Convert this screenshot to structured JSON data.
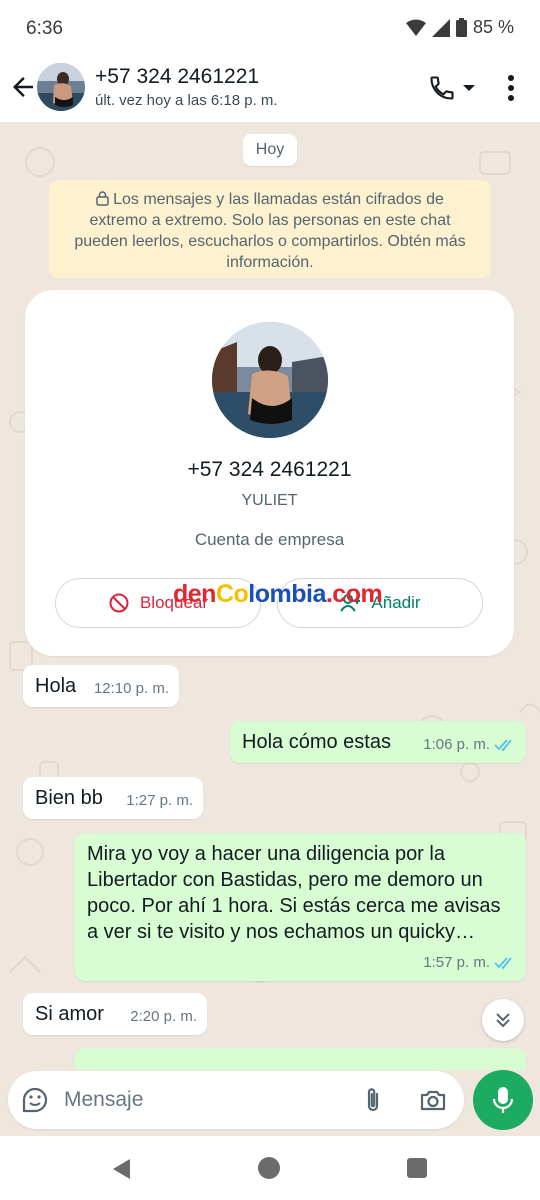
{
  "status_bar": {
    "time": "6:36",
    "battery": "85 %"
  },
  "header": {
    "contact_name": "+57 324 2461221",
    "last_seen": "últ. vez hoy a las 6:18 p. m."
  },
  "chat": {
    "date_chip": "Hoy",
    "encryption_notice": "Los mensajes y las llamadas están cifrados de extremo a extremo. Solo las personas en este chat pueden leerlos, escucharlos o compartirlos. Obtén más información.",
    "contact_card": {
      "phone": "+57 324 2461221",
      "username": "YULIET",
      "account_type": "Cuenta de empresa",
      "block_label": "Bloquear",
      "add_label": "Añadir"
    },
    "watermark": {
      "part1": "den",
      "part2": "Co",
      "part3": "lombia",
      "part4": ".com"
    },
    "messages": [
      {
        "direction": "in",
        "text": "Hola",
        "time": "12:10 p. m."
      },
      {
        "direction": "out",
        "text": "Hola cómo estas",
        "time": "1:06 p. m.",
        "status": "read"
      },
      {
        "direction": "in",
        "text": "Bien bb",
        "time": "1:27 p. m."
      },
      {
        "direction": "out",
        "text": "Mira yo voy a hacer una diligencia por la Libertador con Bastidas, pero me demoro un poco. Por ahí 1 hora. Si estás cerca me avisas a ver si te visito y nos echamos un quicky…",
        "time": "1:57 p. m.",
        "status": "read"
      },
      {
        "direction": "in",
        "text": "Si amor",
        "time": "2:20 p. m."
      }
    ]
  },
  "compose": {
    "placeholder": "Mensaje"
  },
  "colors": {
    "outgoing_bubble": "#d9fdd3",
    "incoming_bubble": "#ffffff",
    "chat_background": "#efe7de",
    "accent_green": "#1daa61",
    "read_tick": "#53bdeb",
    "block_red": "#d9253d"
  },
  "icons": [
    "back-arrow-icon",
    "phone-icon",
    "dropdown-icon",
    "more-vert-icon",
    "lock-icon",
    "block-icon",
    "add-contact-icon",
    "double-check-icon",
    "chevron-double-down-icon",
    "sticker-icon",
    "paperclip-icon",
    "camera-icon",
    "mic-icon"
  ]
}
